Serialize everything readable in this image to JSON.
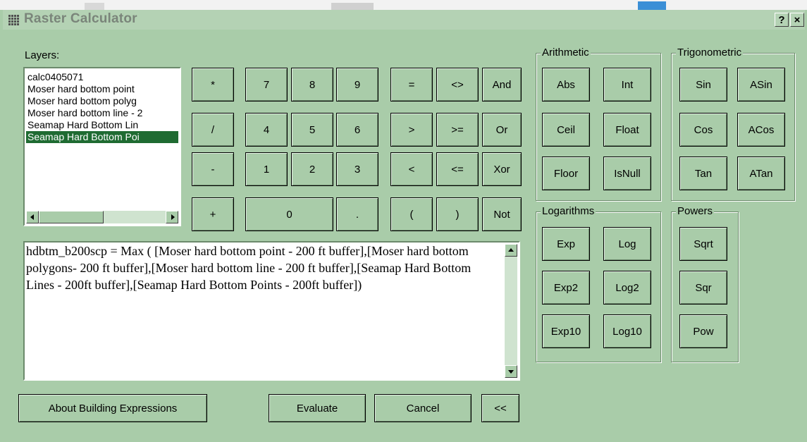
{
  "window": {
    "title": "Raster Calculator",
    "help_label": "?",
    "close_label": "×"
  },
  "layers": {
    "label": "Layers:",
    "items": [
      "calc0405071",
      "Moser  hard bottom point",
      "Moser  hard bottom polyg",
      "Moser hard bottom line - 2",
      "Seamap Hard Bottom Lin",
      "Seamap Hard Bottom Poi"
    ],
    "selected_index": 5
  },
  "keypad": {
    "operators_left": [
      "*",
      "/",
      "-",
      "+"
    ],
    "digits_row1": [
      "7",
      "8",
      "9"
    ],
    "digits_row2": [
      "4",
      "5",
      "6"
    ],
    "digits_row3": [
      "1",
      "2",
      "3"
    ],
    "zero": "0",
    "dot": ".",
    "compare_col1": [
      "=",
      ">",
      "<",
      "("
    ],
    "compare_col2": [
      "<>",
      ">=",
      "<=",
      ")"
    ],
    "logic": [
      "And",
      "Or",
      "Xor",
      "Not"
    ]
  },
  "expression": "hdbtm_b200scp = Max ( [Moser  hard bottom point - 200 ft buffer],[Moser  hard bottom polygons- 200 ft buffer],[Moser hard bottom line - 200 ft buffer],[Seamap Hard Bottom Lines - 200ft buffer],[Seamap Hard Bottom Points - 200ft buffer])",
  "groups": {
    "arithmetic": {
      "label": "Arithmetic",
      "buttons": [
        "Abs",
        "Int",
        "Ceil",
        "Float",
        "Floor",
        "IsNull"
      ]
    },
    "trigonometric": {
      "label": "Trigonometric",
      "buttons": [
        "Sin",
        "ASin",
        "Cos",
        "ACos",
        "Tan",
        "ATan"
      ]
    },
    "logarithms": {
      "label": "Logarithms",
      "buttons": [
        "Exp",
        "Log",
        "Exp2",
        "Log2",
        "Exp10",
        "Log10"
      ]
    },
    "powers": {
      "label": "Powers",
      "buttons": [
        "Sqrt",
        "Sqr",
        "Pow"
      ]
    }
  },
  "footer": {
    "about": "About Building Expressions",
    "evaluate": "Evaluate",
    "cancel": "Cancel",
    "collapse": "<<"
  }
}
